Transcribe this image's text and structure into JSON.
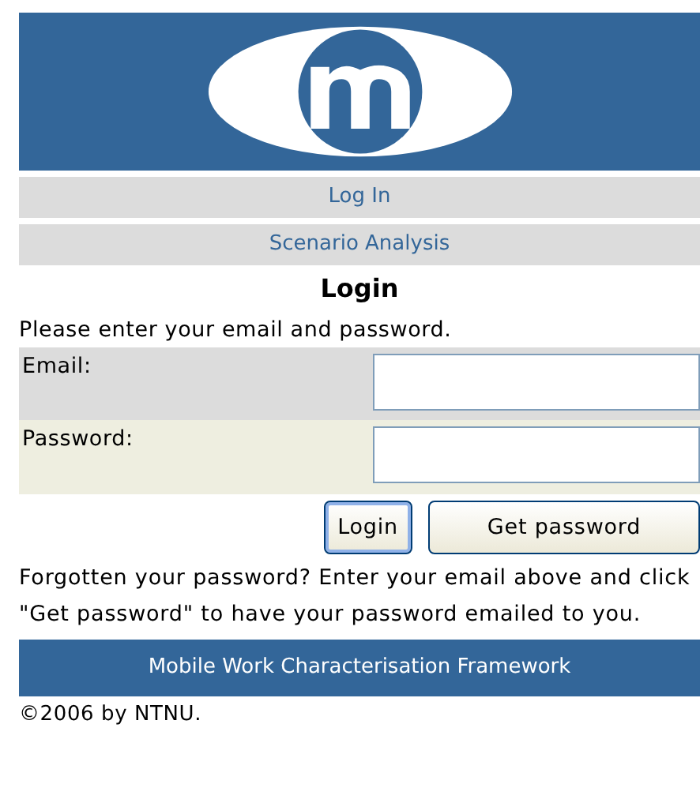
{
  "nav": [
    {
      "label": "Log In"
    },
    {
      "label": "Scenario Analysis"
    }
  ],
  "title": "Login",
  "intro": "Please enter your email and password.",
  "fields": [
    {
      "label": "Email:"
    },
    {
      "label": "Password:"
    }
  ],
  "buttons": [
    {
      "label": "Login",
      "kind": "default"
    },
    {
      "label": "Get password",
      "kind": "normal"
    }
  ],
  "help": "Forgotten your password? Enter your email above and click \"Get password\" to have your password emailed to you.",
  "footer": "Mobile Work Characterisation Framework",
  "copyright": "©2006 by NTNU."
}
